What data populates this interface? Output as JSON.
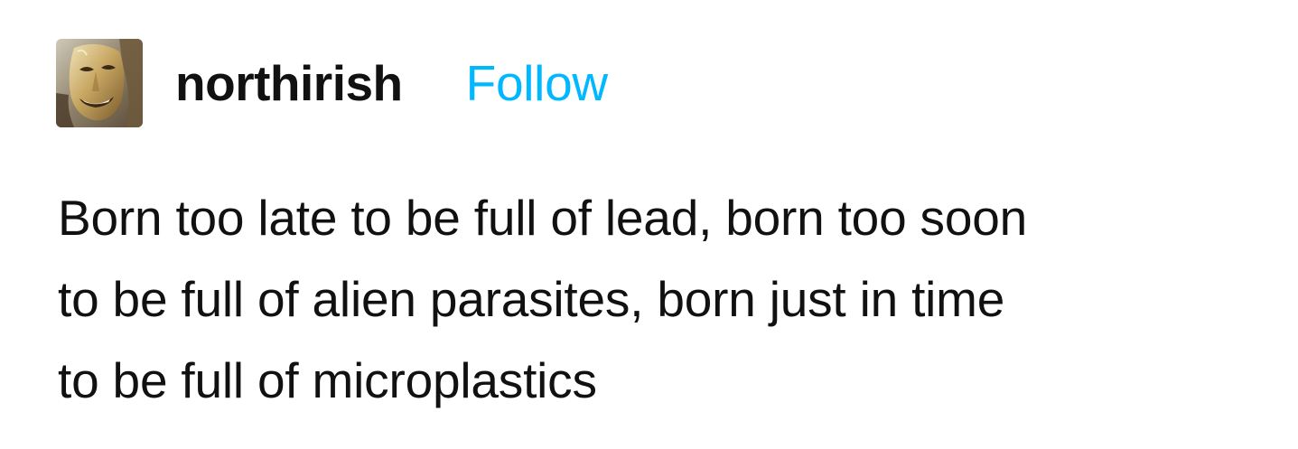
{
  "post": {
    "author": {
      "username": "northirish",
      "avatar_icon": "golden-mask-avatar"
    },
    "follow_label": "Follow",
    "text_lines": [
      "Born too late to be full of lead, born too soon",
      "to be full of alien parasites, born just in time",
      "to be full of microplastics"
    ]
  },
  "colors": {
    "follow": "#00b8ff",
    "text": "#111111",
    "background": "#ffffff"
  }
}
